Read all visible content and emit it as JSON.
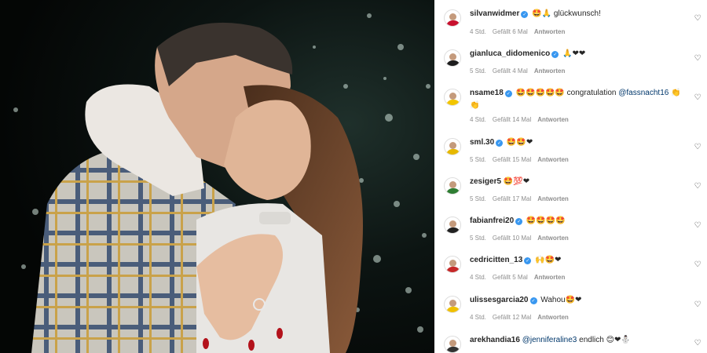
{
  "comments": [
    {
      "username": "silvanwidmer",
      "verified": true,
      "avatar_color": "#c8102e",
      "emoji": "🤩🙏",
      "text": "glückwunsch!",
      "time": "4 Std.",
      "likes": "Gefällt 6 Mal",
      "reply": "Antworten"
    },
    {
      "username": "gianluca_didomenico",
      "verified": true,
      "avatar_color": "#1d1d1d",
      "emoji": "🙏❤❤",
      "text": "",
      "time": "5 Std.",
      "likes": "Gefällt 4 Mal",
      "reply": "Antworten"
    },
    {
      "username": "nsame18",
      "verified": true,
      "avatar_color": "#f2c500",
      "emoji": "🤩🤩🤩🤩🤩",
      "text": "congratulation",
      "mention": "@fassnacht16",
      "emoji_after": "👏👏",
      "time": "4 Std.",
      "likes": "Gefällt 14 Mal",
      "reply": "Antworten"
    },
    {
      "username": "sml.30",
      "verified": true,
      "avatar_color": "#e6b800",
      "emoji": "🤩🤩❤",
      "text": "",
      "time": "5 Std.",
      "likes": "Gefällt 15 Mal",
      "reply": "Antworten"
    },
    {
      "username": "zesiger5",
      "verified": false,
      "avatar_color": "#2e7d32",
      "emoji": "🤩💯❤",
      "text": "",
      "time": "5 Std.",
      "likes": "Gefällt 17 Mal",
      "reply": "Antworten"
    },
    {
      "username": "fabianfrei20",
      "verified": true,
      "avatar_color": "#212121",
      "emoji": "🤩🤩🤩🤩",
      "text": "",
      "time": "5 Std.",
      "likes": "Gefällt 10 Mal",
      "reply": "Antworten"
    },
    {
      "username": "cedricitten_13",
      "verified": true,
      "avatar_color": "#c62828",
      "emoji": "🙌🤩❤",
      "text": "",
      "time": "4 Std.",
      "likes": "Gefällt 5 Mal",
      "reply": "Antworten"
    },
    {
      "username": "ulissesgarcia20",
      "verified": true,
      "avatar_color": "#f0c000",
      "emoji": "",
      "text": "Wahou🤩❤",
      "time": "4 Std.",
      "likes": "Gefällt 12 Mal",
      "reply": "Antworten"
    },
    {
      "username": "arekhandia16",
      "verified": false,
      "avatar_color": "#333333",
      "emoji": "",
      "text": "endlich 😊❤⛄",
      "mention_before": "@jenniferaline3",
      "time": "",
      "likes": "",
      "reply": ""
    }
  ],
  "icons": {
    "heart": "heart-outline-icon",
    "verified": "verified-badge-icon"
  }
}
